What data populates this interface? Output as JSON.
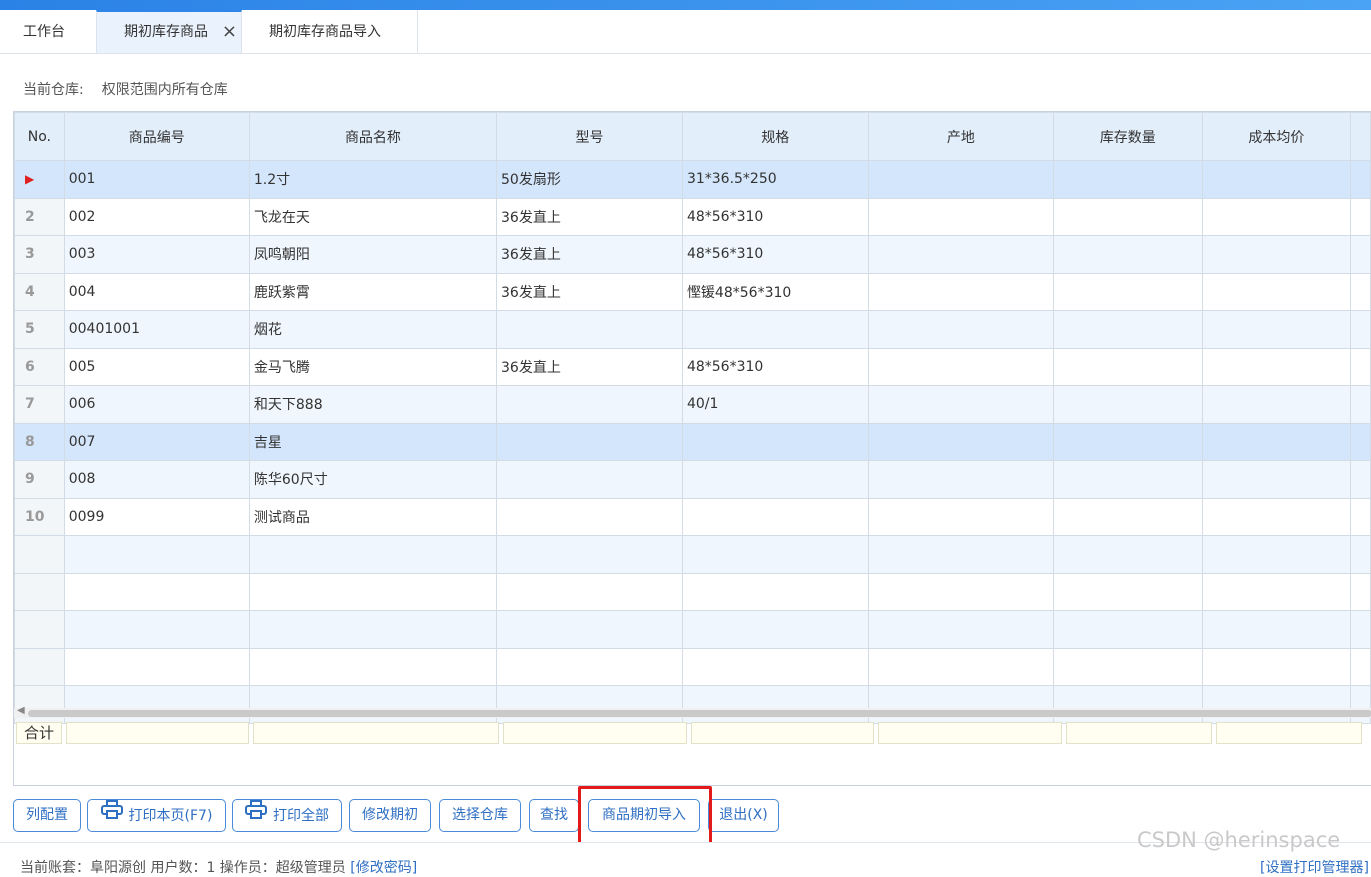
{
  "tabs": [
    {
      "label": "工作台"
    },
    {
      "label": "期初库存商品",
      "active": true
    },
    {
      "label": "期初库存商品导入"
    }
  ],
  "tab_close_icon": "×",
  "warehouse": {
    "label": "当前仓库:",
    "value": "权限范围内所有仓库"
  },
  "table": {
    "columns": [
      "No.",
      "商品编号",
      "商品名称",
      "型号",
      "规格",
      "产地",
      "库存数量",
      "成本均价"
    ],
    "rows": [
      {
        "no": "",
        "code": "001",
        "name": "1.2寸",
        "model": "50发扇形",
        "spec": "31*36.5*250",
        "origin": "",
        "qty": "",
        "cost": ""
      },
      {
        "no": "2",
        "code": "002",
        "name": "飞龙在天",
        "model": "36发直上",
        "spec": "48*56*310",
        "origin": "",
        "qty": "",
        "cost": ""
      },
      {
        "no": "3",
        "code": "003",
        "name": "凤鸣朝阳",
        "model": "36发直上",
        "spec": "48*56*310",
        "origin": "",
        "qty": "",
        "cost": ""
      },
      {
        "no": "4",
        "code": "004",
        "name": "鹿跃紫霄",
        "model": "36发直上",
        "spec": "慳锾48*56*310",
        "origin": "",
        "qty": "",
        "cost": ""
      },
      {
        "no": "5",
        "code": "00401001",
        "name": "烟花",
        "model": "",
        "spec": "",
        "origin": "",
        "qty": "",
        "cost": ""
      },
      {
        "no": "6",
        "code": "005",
        "name": "金马飞腾",
        "model": "36发直上",
        "spec": "48*56*310",
        "origin": "",
        "qty": "",
        "cost": ""
      },
      {
        "no": "7",
        "code": "006",
        "name": "和天下888",
        "model": "",
        "spec": "40/1",
        "origin": "",
        "qty": "",
        "cost": ""
      },
      {
        "no": "8",
        "code": "007",
        "name": "吉星",
        "model": "",
        "spec": "",
        "origin": "",
        "qty": "",
        "cost": ""
      },
      {
        "no": "9",
        "code": "008",
        "name": "陈华60尺寸",
        "model": "",
        "spec": "",
        "origin": "",
        "qty": "",
        "cost": ""
      },
      {
        "no": "10",
        "code": "0099",
        "name": "测试商品",
        "model": "",
        "spec": "",
        "origin": "",
        "qty": "",
        "cost": ""
      }
    ],
    "current_row_marker": "▶",
    "sum_label": "合计"
  },
  "buttons": {
    "col_config": "列配置",
    "print_page": "打印本页(F7)",
    "print_all": "打印全部",
    "edit_initial": "修改期初",
    "select_warehouse": "选择仓库",
    "find": "查找",
    "import_initial": "商品期初导入",
    "exit": "退出(X)"
  },
  "footer": {
    "left_text": "当前账套：阜阳源创   用户数：1   操作员：超级管理员",
    "left_link": "[修改密码]",
    "right_link": "[设置打印管理器]"
  },
  "watermark": "CSDN @herinspace",
  "colors": {
    "accent": "#2f86e8",
    "highlight_box": "#e21a1a",
    "header_bg": "#e3eefb",
    "selected_row": "#d4e6fb"
  }
}
